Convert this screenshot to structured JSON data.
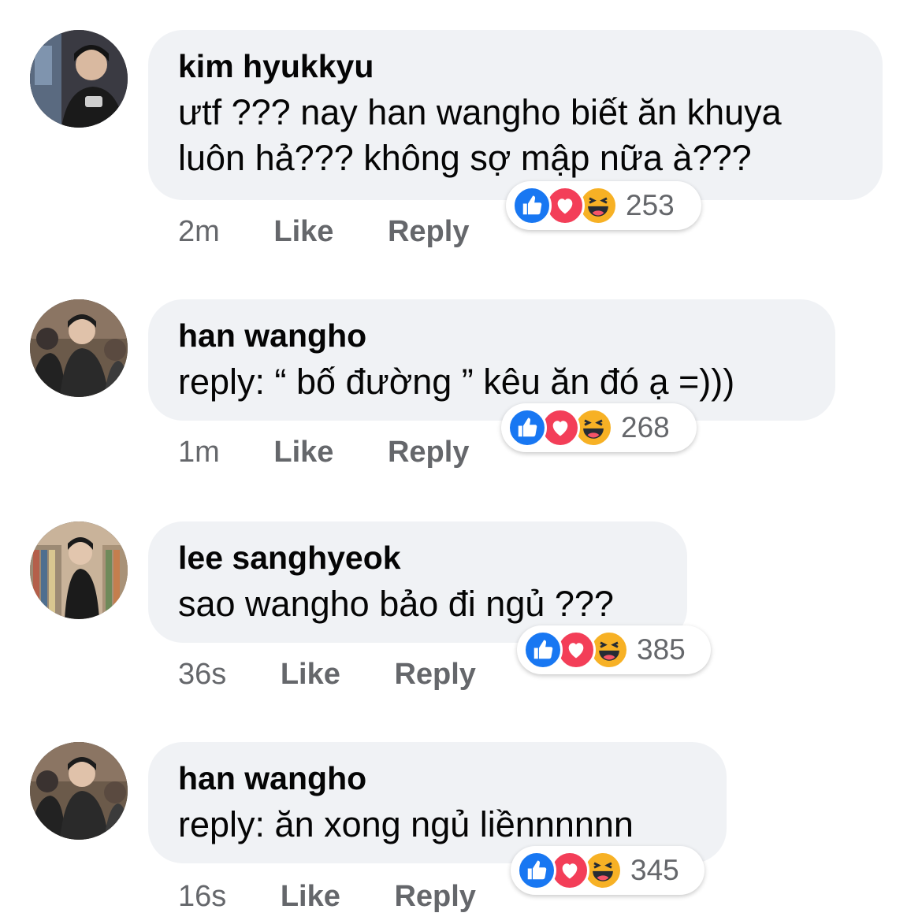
{
  "comments": [
    {
      "author": "kim hyukkyu",
      "text": "ưtf ??? nay han wangho biết ăn khuya luôn hả??? không sợ mập nữa à???",
      "time": "2m",
      "like_label": "Like",
      "reply_label": "Reply",
      "reaction_count": "253"
    },
    {
      "author": "han wangho",
      "text": "reply: “ bố đường ” kêu ăn đó ạ =)))",
      "time": "1m",
      "like_label": "Like",
      "reply_label": "Reply",
      "reaction_count": "268"
    },
    {
      "author": "lee sanghyeok",
      "text": "sao wangho bảo đi ngủ ???",
      "time": "36s",
      "like_label": "Like",
      "reply_label": "Reply",
      "reaction_count": "385"
    },
    {
      "author": "han wangho",
      "text": "reply: ăn xong ngủ liềnnnnnn",
      "time": "16s",
      "like_label": "Like",
      "reply_label": "Reply",
      "reaction_count": "345"
    }
  ],
  "reaction_icons": [
    "thumbs-up-icon",
    "heart-icon",
    "laughing-face-icon"
  ],
  "colors": {
    "bubble": "#f0f2f5",
    "meta_text": "#65676b",
    "like_blue": "#1877f2",
    "love_red": "#f33e58",
    "haha_yellow": "#f7b125"
  }
}
